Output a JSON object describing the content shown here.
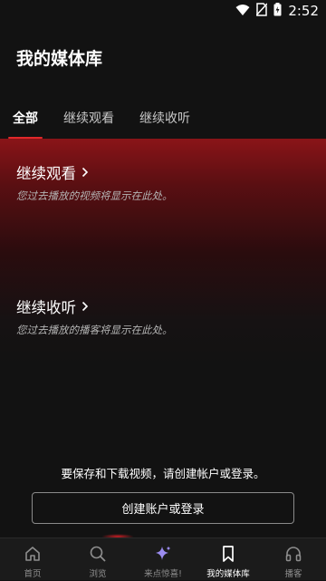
{
  "status_bar": {
    "time": "2:52"
  },
  "header": {
    "title": "我的媒体库"
  },
  "tabs": [
    {
      "label": "全部"
    },
    {
      "label": "继续观看"
    },
    {
      "label": "继续收听"
    }
  ],
  "sections": {
    "watch": {
      "title": "继续观看",
      "subtitle": "您过去播放的视频将显示在此处。"
    },
    "listen": {
      "title": "继续收听",
      "subtitle": "您过去播放的播客将显示在此处。"
    }
  },
  "signin": {
    "prompt": "要保存和下载视频，请创建帐户或登录。",
    "button_label": "创建账户或登录"
  },
  "bottom_nav": [
    {
      "label": "首页",
      "icon": "home-icon"
    },
    {
      "label": "浏览",
      "icon": "search-icon"
    },
    {
      "label": "来点惊喜!",
      "icon": "sparkle-icon"
    },
    {
      "label": "我的媒体库",
      "icon": "bookmark-icon"
    },
    {
      "label": "播客",
      "icon": "headphones-icon"
    }
  ],
  "colors": {
    "accent": "#e0282a",
    "background": "#121212",
    "sparkle": "#9b8cf0"
  }
}
